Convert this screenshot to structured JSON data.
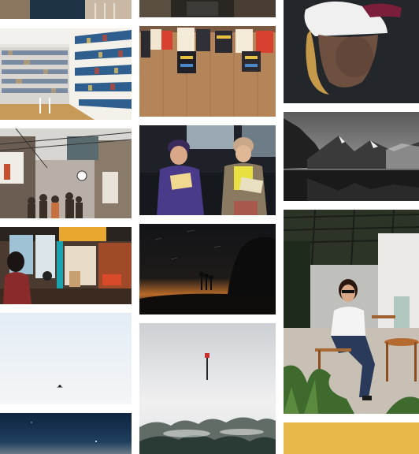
{
  "gallery": {
    "columns": [
      {
        "photos": [
          {
            "icon": "photo-person-in-jacket"
          },
          {
            "icon": "photo-library-bookshelves"
          },
          {
            "icon": "photo-crowded-alley-street"
          },
          {
            "icon": "photo-cafe-interior-with-woman"
          },
          {
            "icon": "photo-white-sky-with-bird"
          },
          {
            "icon": "photo-dusk-sky"
          }
        ]
      },
      {
        "photos": [
          {
            "icon": "photo-dark-interior"
          },
          {
            "icon": "photo-posters-on-wooden-wall"
          },
          {
            "icon": "photo-women-reading-on-subway"
          },
          {
            "icon": "photo-night-sky-long-exposure"
          },
          {
            "icon": "photo-misty-rocks-with-marker-pole"
          }
        ]
      },
      {
        "photos": [
          {
            "icon": "photo-person-wearing-beanie"
          },
          {
            "icon": "photo-mountain-lake-black-and-white"
          },
          {
            "icon": "photo-woman-sitting-on-patio"
          },
          {
            "icon": "photo-solid-mustard"
          }
        ]
      }
    ],
    "colors": {
      "background": "#ffffff",
      "mustard": "#E8B84A"
    }
  }
}
